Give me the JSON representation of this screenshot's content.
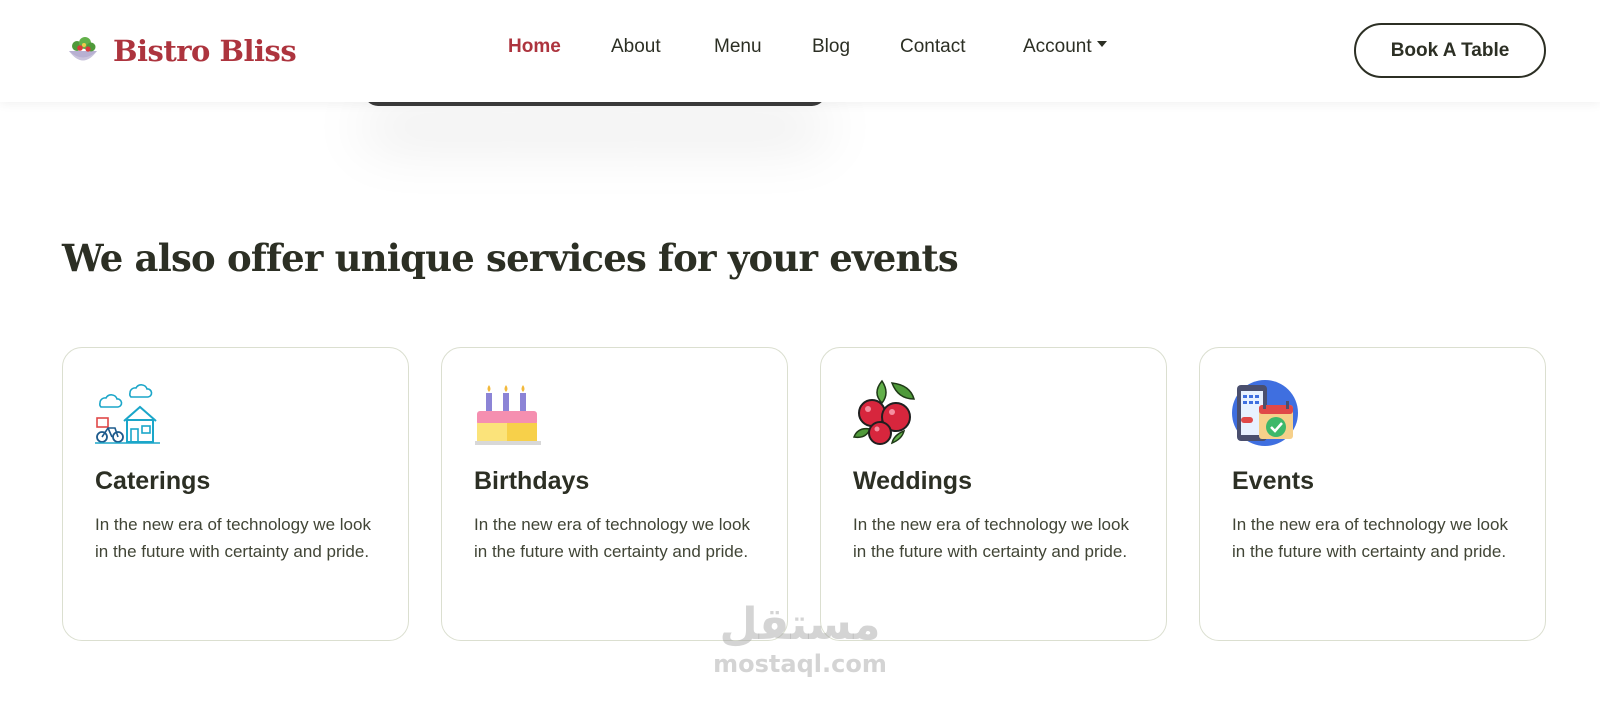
{
  "brand": {
    "name": "Bistro Bliss",
    "logo_icon": "salad-bowl-icon",
    "color": "#ad343e"
  },
  "nav": {
    "items": [
      {
        "label": "Home",
        "active": true
      },
      {
        "label": "About",
        "active": false
      },
      {
        "label": "Menu",
        "active": false
      },
      {
        "label": "Blog",
        "active": false
      },
      {
        "label": "Contact",
        "active": false
      },
      {
        "label": "Account",
        "active": false,
        "dropdown": true
      }
    ],
    "cta_label": "Book A Table"
  },
  "services": {
    "title": "We also offer unique services for your events",
    "cards": [
      {
        "title": "Caterings",
        "text": "In the new era of technology we look in the future with certainty and pride.",
        "icon": "delivery-house-icon"
      },
      {
        "title": "Birthdays",
        "text": "In the new era of technology we look in the future with certainty and pride.",
        "icon": "birthday-cake-icon"
      },
      {
        "title": "Weddings",
        "text": "In the new era of technology we look in the future with certainty and pride.",
        "icon": "berries-icon"
      },
      {
        "title": "Events",
        "text": "In the new era of technology we look in the future with certainty and pride.",
        "icon": "calendar-phone-icon"
      }
    ]
  },
  "watermark": {
    "arabic": "مستقل",
    "latin": "mostaql.com"
  }
}
